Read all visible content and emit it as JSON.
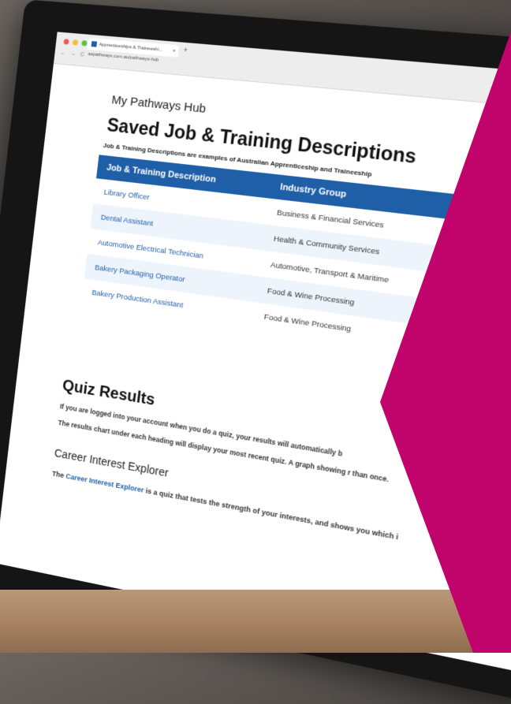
{
  "browser": {
    "tab_title": "Apprenticeships & Traineeshi...",
    "tab_close": "×",
    "new_tab": "+",
    "nav": [
      "←",
      "→",
      "C"
    ],
    "url": "aapathways.com.au/pathways-hub"
  },
  "page": {
    "hub_label": "My Pathways Hub",
    "heading": "Saved Job & Training Descriptions",
    "intro": "Job & Training Descriptions are examples of Australian Apprenticeship and Traineeship",
    "table": {
      "headers": [
        "Job & Training Description",
        "Industry Group"
      ],
      "rows": [
        {
          "job": "Library Officer",
          "industry": "Business & Financial Services"
        },
        {
          "job": "Dental Assistant",
          "industry": "Health & Community Services"
        },
        {
          "job": "Automotive Electrical Technician",
          "industry": "Automotive, Transport & Maritime"
        },
        {
          "job": "Bakery Packaging Operator",
          "industry": "Food & Wine Processing"
        },
        {
          "job": "Bakery Production Assistant",
          "industry": "Food & Wine Processing"
        }
      ]
    },
    "quiz_title": "Quiz Results",
    "quiz_para1": "If you are logged into your account when you do a quiz, your results will automatically b",
    "quiz_para2": "The results chart under each heading will display your most recent quiz. A graph showing r than once.",
    "career_heading": "Career Interest Explorer",
    "career_pre": "The",
    "career_link": "Career Interest Explorer",
    "career_post": "is a quiz that tests the strength of your interests, and shows you which i"
  },
  "colors": {
    "brand_blue": "#1f5fa8",
    "overlay_magenta": "#c0046c"
  }
}
